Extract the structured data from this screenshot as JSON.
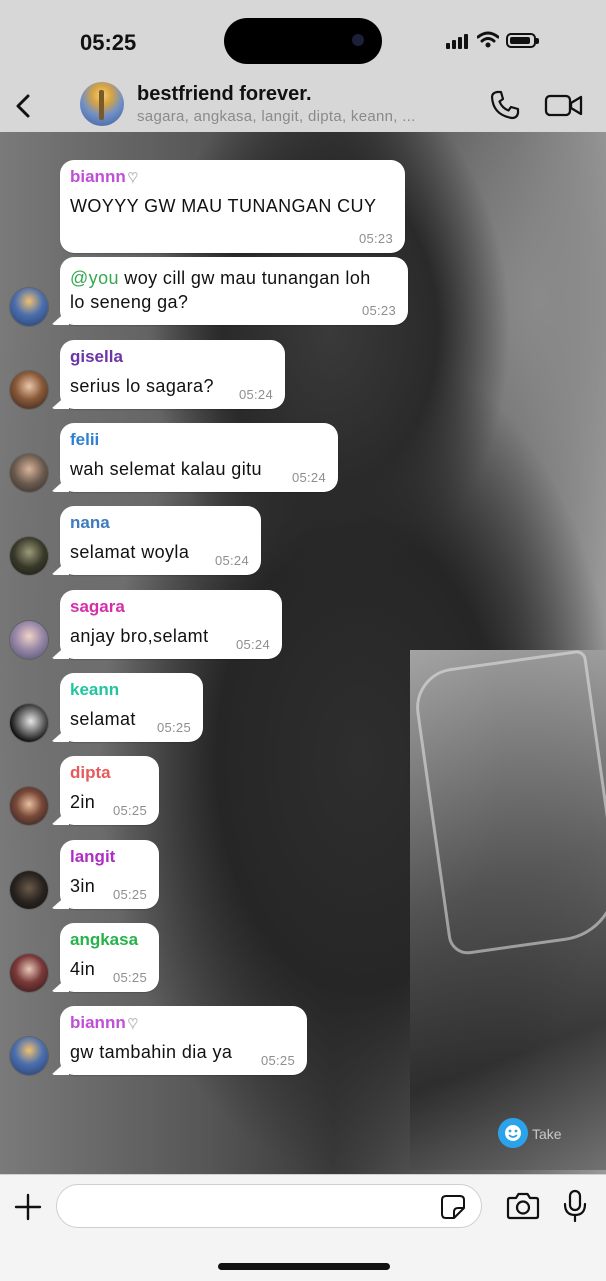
{
  "status_bar": {
    "time": "05:25"
  },
  "header": {
    "title": "bestfriend forever.",
    "members": "sagara, angkasa, langit, dipta, keann, ..."
  },
  "colors": {
    "biannn": "#c04fd6",
    "gisella": "#6b34a8",
    "felii": "#2f7fd2",
    "nana": "#3f7bbf",
    "sagara": "#d42fa8",
    "keann": "#20c6a0",
    "dipta": "#e55b5b",
    "langit": "#b02cc7",
    "angkasa": "#27b24a",
    "mention": "#36a851"
  },
  "messages": [
    {
      "sender": "biannn",
      "text": "WOYYY GW MAU TUNANGAN CUY",
      "time": "05:23"
    },
    {
      "mention": "@you",
      "text": " woy cill gw mau tunangan loh\nlo seneng ga?",
      "time": "05:23"
    },
    {
      "sender": "gisella",
      "text": "serius lo sagara?",
      "time": "05:24"
    },
    {
      "sender": "felii",
      "text": "wah selemat kalau gitu",
      "time": "05:24"
    },
    {
      "sender": "nana",
      "text": "selamat woyla",
      "time": "05:24"
    },
    {
      "sender": "sagara",
      "text": "anjay bro,selamt",
      "time": "05:24"
    },
    {
      "sender": "keann",
      "text": "selamat",
      "time": "05:25"
    },
    {
      "sender": "dipta",
      "text": "2in",
      "time": "05:25"
    },
    {
      "sender": "langit",
      "text": "3in",
      "time": "05:25"
    },
    {
      "sender": "angkasa",
      "text": "4in",
      "time": "05:25"
    },
    {
      "sender": "biannn",
      "text": "gw tambahin dia ya",
      "time": "05:25"
    }
  ],
  "sticker_hint": {
    "label": "Take"
  },
  "input": {
    "placeholder": ""
  },
  "icons": [
    "back-icon",
    "phone-icon",
    "video-icon",
    "plus-icon",
    "sticker-icon",
    "camera-icon",
    "microphone-icon"
  ]
}
